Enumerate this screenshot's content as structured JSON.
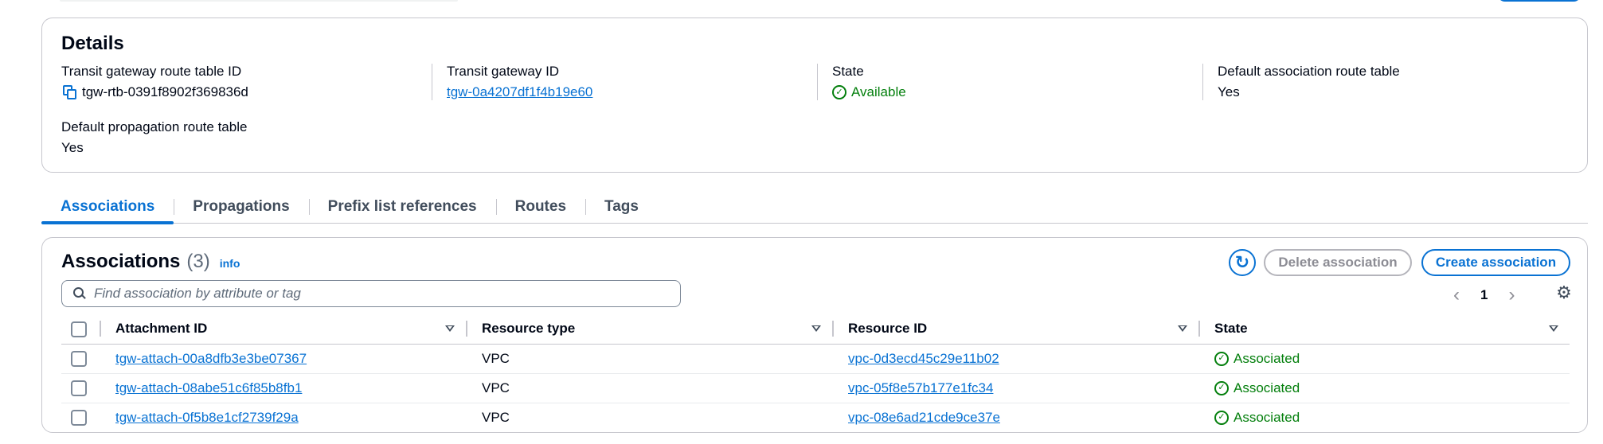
{
  "details": {
    "title": "Details",
    "fields": [
      {
        "label": "Transit gateway route table ID",
        "value": "tgw-rtb-0391f8902f369836d",
        "icon": "copy-icon"
      },
      {
        "label": "Transit gateway ID",
        "value": "tgw-0a4207df1f4b19e60"
      },
      {
        "label": "State",
        "value": "Available",
        "icon": "check-circle-icon"
      },
      {
        "label": "Default association route table",
        "value": "Yes"
      },
      {
        "label": "Default propagation route table",
        "value": "Yes"
      }
    ]
  },
  "tabs": [
    {
      "label": "Associations",
      "active": true
    },
    {
      "label": "Propagations"
    },
    {
      "label": "Prefix list references"
    },
    {
      "label": "Routes"
    },
    {
      "label": "Tags"
    }
  ],
  "associations": {
    "title": "Associations",
    "count": "(3)",
    "info_label": "info",
    "delete_label": "Delete association",
    "create_label": "Create association",
    "search_placeholder": "Find association by attribute or tag",
    "page": "1",
    "columns": [
      "Attachment ID",
      "Resource type",
      "Resource ID",
      "State"
    ],
    "rows": [
      {
        "attachment_id": "tgw-attach-00a8dfb3e3be07367",
        "resource_type": "VPC",
        "resource_id": "vpc-0d3ecd45c29e11b02",
        "state": "Associated"
      },
      {
        "attachment_id": "tgw-attach-08abe51c6f85b8fb1",
        "resource_type": "VPC",
        "resource_id": "vpc-05f8e57b177e1fc34",
        "state": "Associated"
      },
      {
        "attachment_id": "tgw-attach-0f5b8e1cf2739f29a",
        "resource_type": "VPC",
        "resource_id": "vpc-08e6ad21cde9ce37e",
        "state": "Associated"
      }
    ]
  },
  "colors": {
    "link": "#0972d3",
    "success": "#037f0c",
    "border": "#c6c6cd"
  }
}
